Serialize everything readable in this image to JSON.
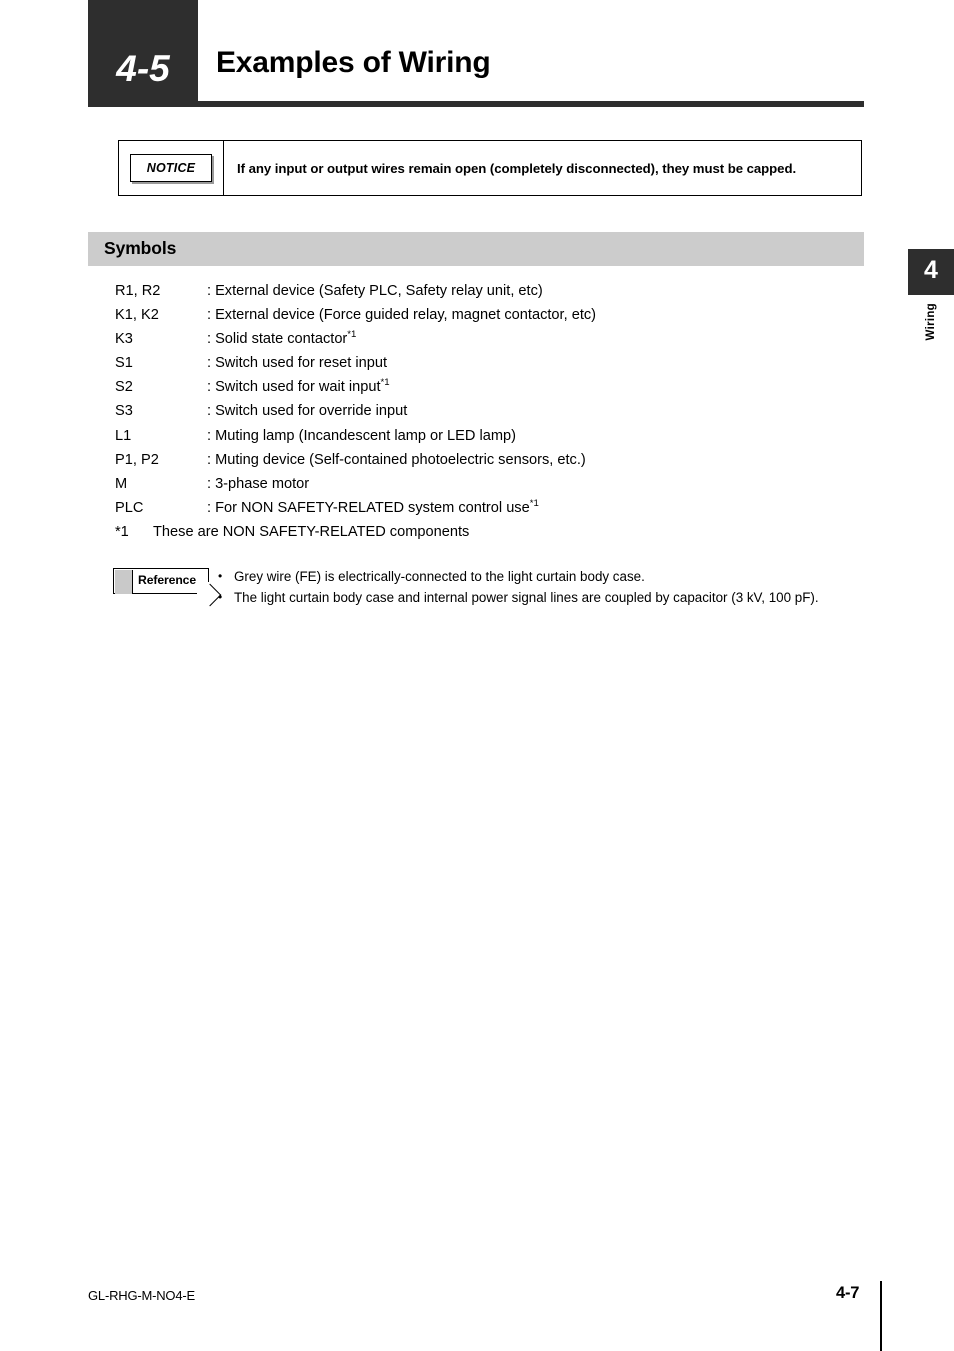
{
  "header": {
    "chapter_number": "4-5",
    "title": "Examples of Wiring"
  },
  "notice": {
    "label": "NOTICE",
    "text": "If any input or output wires remain open (completely disconnected), they must be capped."
  },
  "symbols_section": {
    "heading": "Symbols",
    "items": [
      {
        "key": "R1, R2",
        "colon": ":",
        "desc": "External device (Safety PLC, Safety relay unit, etc)",
        "sup": ""
      },
      {
        "key": "K1, K2",
        "colon": ":",
        "desc": "External device (Force guided relay, magnet contactor, etc)",
        "sup": ""
      },
      {
        "key": "K3",
        "colon": ":",
        "desc": "Solid state contactor",
        "sup": "*1"
      },
      {
        "key": "S1",
        "colon": ":",
        "desc": "Switch used for reset input",
        "sup": ""
      },
      {
        "key": "S2",
        "colon": ":",
        "desc": "Switch used for wait input",
        "sup": "*1"
      },
      {
        "key": "S3",
        "colon": ":",
        "desc": "Switch used for override input",
        "sup": ""
      },
      {
        "key": "L1",
        "colon": ":",
        "desc": "Muting lamp (Incandescent lamp or LED lamp)",
        "sup": ""
      },
      {
        "key": "P1, P2",
        "colon": ":",
        "desc": "Muting device (Self-contained photoelectric sensors, etc.)",
        "sup": ""
      },
      {
        "key": "M",
        "colon": ":",
        "desc": "3-phase motor",
        "sup": ""
      },
      {
        "key": "PLC",
        "colon": ":",
        "desc": "For NON SAFETY-RELATED system control use",
        "sup": "*1"
      }
    ],
    "footnote_mark": "*1",
    "footnote_text": "These are NON SAFETY-RELATED components"
  },
  "reference": {
    "label": "Reference",
    "bullets": [
      "Grey wire (FE) is electrically-connected to the light curtain body case.",
      "The light curtain body case and internal power signal lines are coupled by capacitor (3 kV, 100 pF)."
    ]
  },
  "side_tab": {
    "number": "4",
    "label": "Wiring"
  },
  "footer": {
    "document_code": "GL-RHG-M-NO4-E",
    "page_number": "4-7"
  },
  "colors": {
    "dark": "#2e2e2e",
    "band_grey": "#cccccc",
    "swatch_grey": "#c9c9c9"
  }
}
